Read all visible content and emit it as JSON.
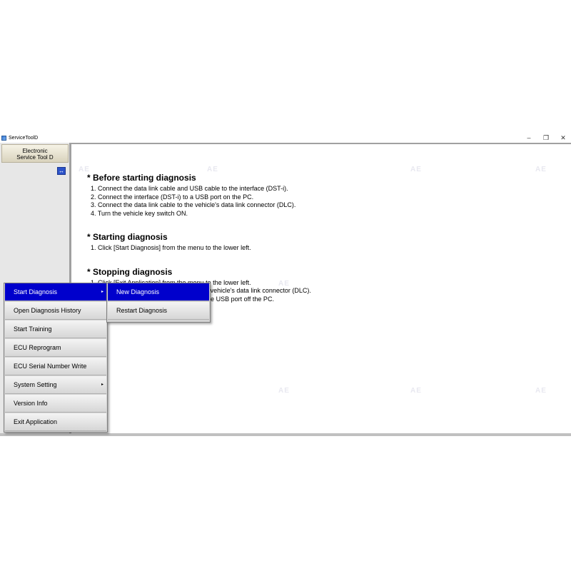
{
  "window": {
    "title": "ServiceToolD",
    "controls": {
      "minimize": "–",
      "restore": "❐",
      "close": "✕"
    }
  },
  "sidebar": {
    "logo_line1": "Electronic",
    "logo_line2": "Service Tool D",
    "switch_icon": "↔"
  },
  "content": {
    "sections": [
      {
        "title": "* Before starting diagnosis",
        "steps": [
          "1. Connect the data link cable and USB cable to the interface (DST-i).",
          "2. Connect the interface (DST-i) to a USB port on the PC.",
          "3. Connect the data link cable to the vehicle's data link connector (DLC).",
          "4. Turn the vehicle key switch ON."
        ]
      },
      {
        "title": "* Starting diagnosis",
        "steps": [
          "1. Click [Start Diagnosis] from the menu to the lower left."
        ]
      },
      {
        "title": "* Stopping diagnosis",
        "steps": [
          "1. Click [Exit Application] from the menu to the lower left.",
          "2. Disconnect the data link cable from the vehicle's data link connector (DLC).",
          "3. Disconnect the interface (DST-i) from the USB port off the PC."
        ]
      }
    ]
  },
  "menu": {
    "items": [
      {
        "label": "Start Diagnosis",
        "has_submenu": true,
        "active": true
      },
      {
        "label": "Open Diagnosis History"
      },
      {
        "label": "Start Training"
      },
      {
        "label": "ECU Reprogram"
      },
      {
        "label": "ECU Serial Number Write"
      },
      {
        "label": "System Setting",
        "has_submenu": true
      },
      {
        "label": "Version Info"
      },
      {
        "label": "Exit Application"
      }
    ],
    "arrow_glyph": "▸"
  },
  "submenu": {
    "items": [
      {
        "label": "New Diagnosis",
        "active": true
      },
      {
        "label": "Restart Diagnosis"
      }
    ]
  },
  "colors": {
    "menu_highlight": "#0000cc",
    "window_bg": "#f0f0f0",
    "sidebar_bg": "#e7e7e7"
  }
}
